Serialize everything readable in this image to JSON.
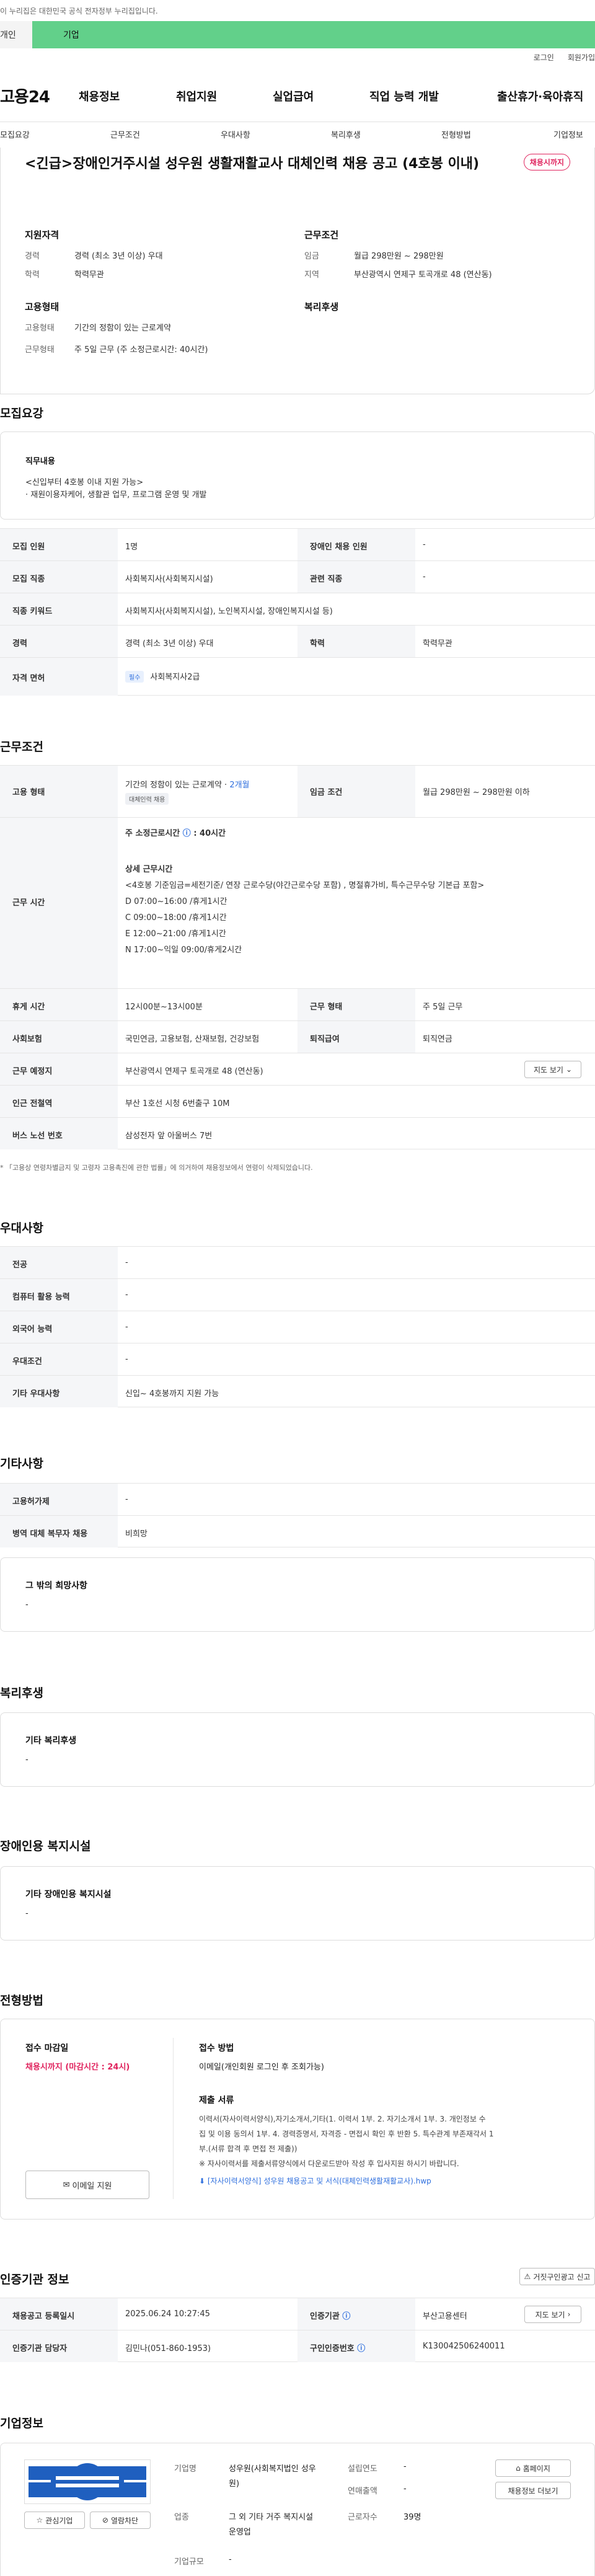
{
  "site": {
    "gov_notice": "이 누리집은 대한민국 공식 전자정부 누리집입니다.",
    "tab_personal": "개인",
    "tab_company": "기업",
    "login": "로그인",
    "signup": "회원가입",
    "logo": "고용24",
    "nav": [
      "채용정보",
      "취업지원",
      "실업급여",
      "직업 능력 개발",
      "출산휴가·육아휴직"
    ],
    "subnav": [
      "모집요강",
      "근무조건",
      "우대사항",
      "복리후생",
      "전형방법",
      "기업정보"
    ]
  },
  "job": {
    "title": "<긴급>장애인거주시설 성우원 생활재활교사 대체인력 채용 공고 (4호봉 이내)",
    "status": "채용시까지",
    "qual_h": "지원자격",
    "qual": [
      {
        "k": "경력",
        "v": "경력 (최소 3년 이상) 우대"
      },
      {
        "k": "학력",
        "v": "학력무관"
      }
    ],
    "cond_h": "근무조건",
    "cond": [
      {
        "k": "임금",
        "v": "월급 298만원 ~ 298만원"
      },
      {
        "k": "지역",
        "v": "부산광역시 연제구 토곡개로 48 (연산동)"
      }
    ],
    "emp_h": "고용형태",
    "emp": [
      {
        "k": "고용형태",
        "v": "기간의 정함이 있는 근로계약"
      },
      {
        "k": "근무형태",
        "v": "주 5일 근무 (주 소정근로시간: 40시간)"
      }
    ],
    "welfare_h": "복리후생"
  },
  "recruit": {
    "h": "모집요강",
    "duty_h": "직무내용",
    "duty_lines": [
      "<신입부터 4호봉 이내 지원 가능>",
      "· 재원이용자케어, 생활관 업무, 프로그램 운영 및 개발"
    ],
    "rows": [
      {
        "k1": "모집 인원",
        "v1": "1명",
        "k2": "장애인 채용 인원",
        "v2": "-"
      },
      {
        "k1": "모집 직종",
        "v1": "사회복지사(사회복지시설)",
        "k2": "관련 직종",
        "v2": "-"
      }
    ],
    "kw_k": "직종 키워드",
    "kw_v": "사회복지사(사회복지시설), 노인복지시설, 장애인복지시설 등)",
    "career_k": "경력",
    "career_v": "경력 (최소 3년 이상) 우대",
    "edu_k": "학력",
    "edu_v": "학력무관",
    "lic_k": "자격 면허",
    "lic_badge": "필수",
    "lic_v": "사회복지사2급"
  },
  "work": {
    "h": "근무조건",
    "type_k": "고용 형태",
    "type_v": "기간의 정함이 있는 근로계약 · ",
    "type_period": "2개월",
    "type_badge": "대체인력 채용",
    "wage_k": "임금 조건",
    "wage_v": "월급 298만원 ~ 298만원 이하",
    "time_k": "근무 시간",
    "weekly": "주 소정근로시간",
    "weekly_v": ": 40시간",
    "detail_h": "상세 근무시간",
    "detail_lines": [
      "<4호봉 기준임금=세전기준/ 연장 근로수당(야간근로수당 포함) , 명절휴가비, 특수근무수당 기본급 포함>",
      "D  07:00~16:00 /휴게1시간",
      "C  09:00~18:00 /휴게1시간",
      "E 12:00~21:00 /휴게1시간",
      "N  17:00~익일 09:00/휴게2시간"
    ],
    "break_k": "휴게 시간",
    "break_v": "12시00분~13시00분",
    "form_k": "근무 형태",
    "form_v": "주 5일 근무",
    "ins_k": "사회보험",
    "ins_v": "국민연금, 고용보험, 산재보험, 건강보험",
    "ret_k": "퇴직급여",
    "ret_v": "퇴직연금",
    "place_k": "근무 예정지",
    "place_v": "부산광역시 연제구 토곡개로 48 (연산동)",
    "map_btn": "지도 보기",
    "subway_k": "인근 전철역",
    "subway_v": "부산 1호선 시청 6번출구 10M",
    "bus_k": "버스 노선 번호",
    "bus_v": "삼성전자 앞 아울버스 7번",
    "footnote": "* 「고용상 연령차별금지 및 고령자 고용촉진에 관한 법률」에 의거하여 채용정보에서 연령이 삭제되었습니다."
  },
  "pref": {
    "h": "우대사항",
    "rows": [
      {
        "k": "전공",
        "v": "-"
      },
      {
        "k": "컴퓨터 활용 능력",
        "v": "-"
      },
      {
        "k": "외국어 능력",
        "v": "-"
      },
      {
        "k": "우대조건",
        "v": "-"
      },
      {
        "k": "기타 우대사항",
        "v": "신입~ 4호봉까지 지원 가능"
      }
    ]
  },
  "etc": {
    "h": "기타사항",
    "rows": [
      {
        "k": "고용허가제",
        "v": "-"
      },
      {
        "k": "병역 대체 복무자 채용",
        "v": "비희망"
      }
    ],
    "other_h": "그 밖의 희망사항",
    "other_v": "-"
  },
  "welfare": {
    "h": "복리후생",
    "box_h": "기타 복리후생",
    "box_v": "-"
  },
  "disabled": {
    "h": "장애인용 복지시설",
    "box_h": "기타 장애인용 복지시설",
    "box_v": "-"
  },
  "process": {
    "h": "전형방법",
    "deadline_h": "접수 마감일",
    "deadline_v": "채용시까지 (마감시간 : 24시)",
    "apply_btn": "이메일 지원",
    "method_h": "접수 방법",
    "method_v": "이메일(개인회원 로그인 후 조회가능)",
    "docs_h": "제출 서류",
    "docs_lines": [
      "이력서(자사이력서양식),자기소개서,기타(1. 이력서 1부. 2. 자기소개서 1부. 3. 개인정보 수",
      "집 및 이용 동의서 1부. 4. 경력증명서, 자격증 - 면접시 확인 후 반환 5. 특수관계 부존재각서 1",
      "부.(서류 합격 후 면접 전 제출))",
      "※ 자사이력서를 제출서류양식에서 다운로드받아 작성 후 입사지원 하시기 바랍니다."
    ],
    "file": "[자사이력서양식] 성우원 채용공고 및 서식(대체인력생활재활교사).hwp"
  },
  "cert": {
    "h": "인증기관 정보",
    "report_btn": "거짓구인광고 신고",
    "reg_k": "채용공고 등록일시",
    "reg_v": "2025.06.24 10:27:45",
    "org_k": "인증기관",
    "org_v": "부산고용센터",
    "map_btn": "지도 보기",
    "mgr_k": "인증기관 담당자",
    "mgr_v": "김민나(051-860-1953)",
    "id_k": "구인인증번호",
    "id_v": "K130042506240011"
  },
  "company": {
    "h": "기업정보",
    "fav_btn": "관심기업",
    "block_btn": "열람차단",
    "name_k": "기업명",
    "name_v": "성우원(사회복지법인 성우원)",
    "year_k": "설립연도",
    "year_v": "-",
    "sales_k": "연매출액",
    "sales_v": "-",
    "ind_k": "업종",
    "ind_v": "그 외 기타 거주 복지시설 운영업",
    "emp_k": "근로자수",
    "emp_v": "39명",
    "scale_k": "기업규모",
    "scale_v": "-",
    "home_btn": "홈페이지",
    "jobs_btn": "채용정보 더보기"
  },
  "colors": {
    "green": "#62d08a",
    "red": "#e0245e",
    "blue": "#2f6fde"
  }
}
